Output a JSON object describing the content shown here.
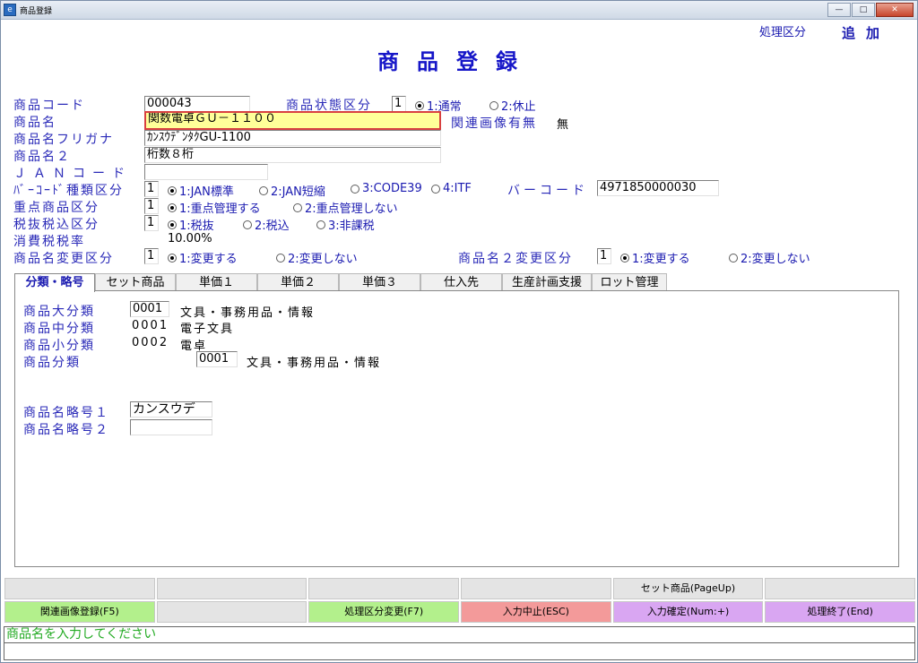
{
  "window": {
    "title": "商品登録",
    "icon_char": "e",
    "buttons": [
      "—",
      "□",
      "✕"
    ]
  },
  "process": {
    "label": "処理区分",
    "value": "追加"
  },
  "header": {
    "title": "商品登録"
  },
  "form": {
    "code": {
      "label": "商品コード",
      "value": "000043"
    },
    "status": {
      "label": "商品状態区分",
      "value": "1",
      "opt1": "1:通常",
      "opt2": "2:休止",
      "selected": 1
    },
    "name": {
      "label": "商品名",
      "value": "関数電卓ＧＵ－１１００"
    },
    "image": {
      "label": "関連画像有無",
      "value": "無"
    },
    "furigana": {
      "label": "商品名フリガナ",
      "value": "ｶﾝｽｳﾃﾞﾝﾀｸGU-1100"
    },
    "name2": {
      "label": "商品名２",
      "value": "桁数８桁"
    },
    "jan": {
      "label": "ＪＡＮコード",
      "value": ""
    },
    "barcode_type": {
      "label": "ﾊﾞｰｺｰﾄﾞ種類区分",
      "value": "1",
      "opt1": "1:JAN標準",
      "opt2": "2:JAN短縮",
      "opt3": "3:CODE39",
      "opt4": "4:ITF",
      "selected": 1
    },
    "barcode": {
      "label": "バーコード",
      "value": "4971850000030"
    },
    "priority": {
      "label": "重点商品区分",
      "value": "1",
      "opt1": "1:重点管理する",
      "opt2": "2:重点管理しない",
      "selected": 1
    },
    "tax": {
      "label": "税抜税込区分",
      "value": "1",
      "opt1": "1:税抜",
      "opt2": "2:税込",
      "opt3": "3:非課税",
      "selected": 1
    },
    "tax_rate": {
      "label": "消費税税率",
      "value": "10.00%"
    },
    "name_change": {
      "label": "商品名変更区分",
      "value": "1",
      "opt1": "1:変更する",
      "opt2": "2:変更しない",
      "selected": 1
    },
    "name2_change": {
      "label": "商品名２変更区分",
      "value": "1",
      "opt1": "1:変更する",
      "opt2": "2:変更しない",
      "selected": 1
    }
  },
  "tabs": [
    "分類・略号",
    "セット商品",
    "単価１",
    "単価２",
    "単価３",
    "仕入先",
    "生産計画支援",
    "ロット管理"
  ],
  "active_tab": 0,
  "classification": {
    "major": {
      "label": "商品大分類",
      "code": "0001",
      "name": "文具・事務用品・情報"
    },
    "middle": {
      "label": "商品中分類",
      "code": "0001",
      "name": "電子文具"
    },
    "minor": {
      "label": "商品小分類",
      "code": "0002",
      "name": "電卓"
    },
    "category": {
      "label": "商品分類",
      "code": "0001",
      "name": "文具・事務用品・情報"
    },
    "abbr1": {
      "label": "商品名略号１",
      "value": "カンスウデ"
    },
    "abbr2": {
      "label": "商品名略号２",
      "value": ""
    }
  },
  "fkeys": {
    "row1": [
      "",
      "",
      "",
      "",
      "セット商品(PageUp)",
      ""
    ],
    "row2": [
      "関連画像登録(F5)",
      "",
      "処理区分変更(F7)",
      "入力中止(ESC)",
      "入力確定(Num:+)",
      "処理終了(End)"
    ]
  },
  "status": {
    "message": "商品名を入力してください"
  },
  "colors": {
    "label_blue": "#2a2ab8",
    "title_blue": "#1616c8",
    "status_green": "#22aa22",
    "btn_green": "#b3f08c",
    "btn_red": "#f39a9a",
    "btn_purple": "#d9a6f2"
  }
}
